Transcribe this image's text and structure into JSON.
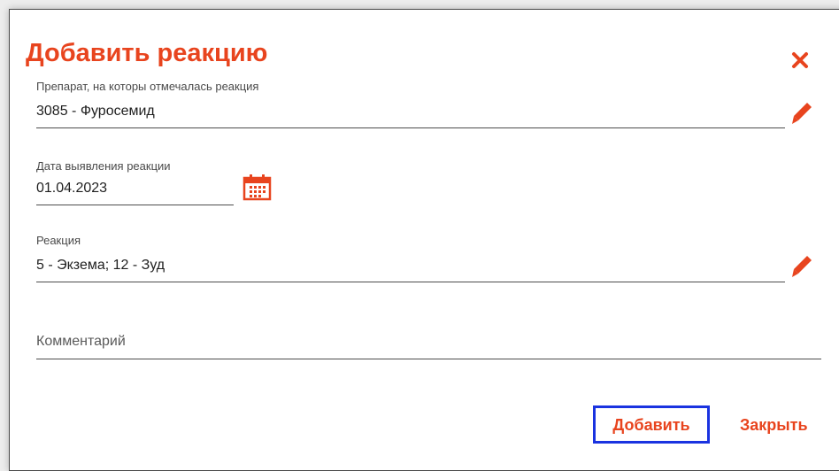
{
  "dialog": {
    "title": "Добавить реакцию",
    "close_icon": "close-icon"
  },
  "fields": {
    "drug": {
      "label": "Препарат, на которы отмечалась реакция",
      "value": "3085 - Фуросемид",
      "action_icon": "pencil-icon"
    },
    "date": {
      "label": "Дата выявления реакции",
      "value": "01.04.2023",
      "action_icon": "calendar-icon"
    },
    "reaction": {
      "label": "Реакция",
      "value": "5 - Экзема; 12 - Зуд",
      "action_icon": "pencil-icon"
    },
    "comment": {
      "placeholder": "Комментарий",
      "value": ""
    }
  },
  "buttons": {
    "add_label": "Добавить",
    "close_label": "Закрыть"
  },
  "colors": {
    "accent": "#e8441e",
    "focus_border": "#1a33e0"
  }
}
